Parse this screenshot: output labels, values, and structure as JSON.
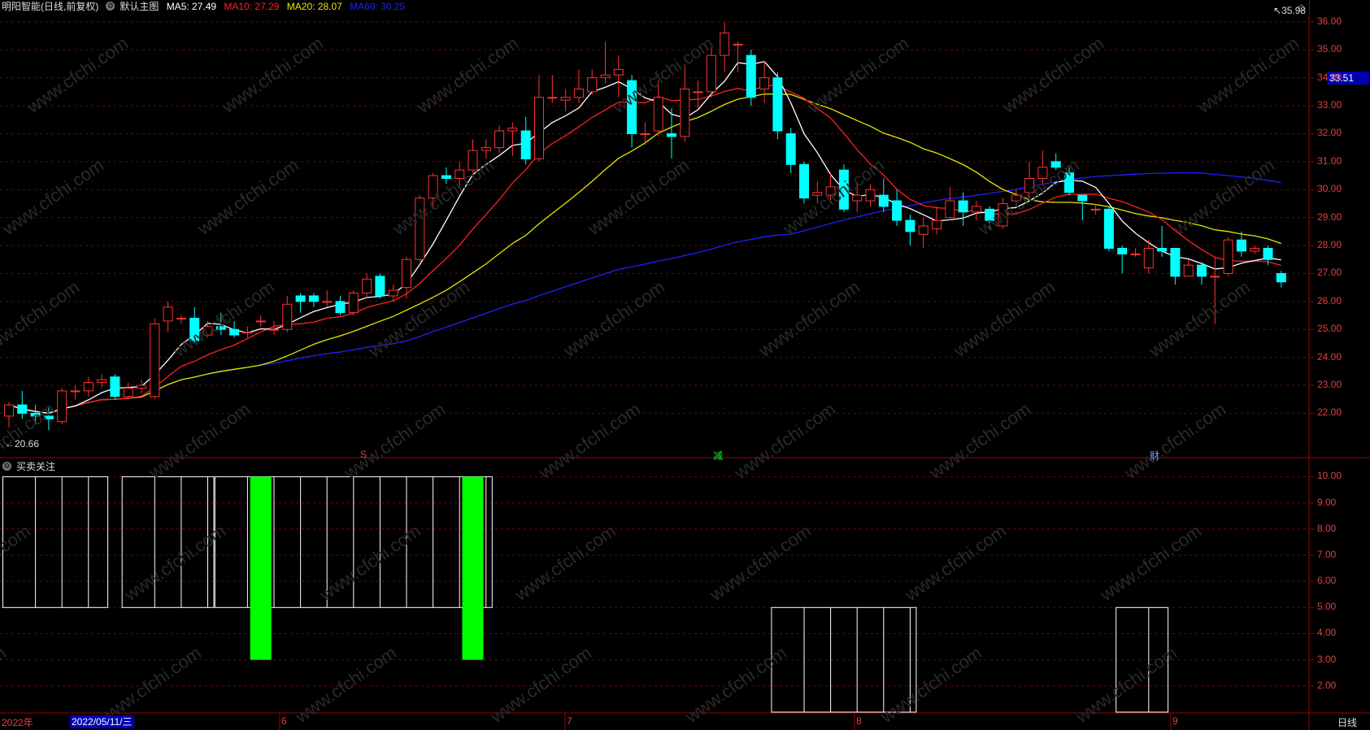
{
  "header": {
    "stock": "明阳智能(日线,前复权)",
    "view": "默认主图",
    "ma5": "MA5: 27.49",
    "ma10": "MA10: 27.29",
    "ma20": "MA20: 28.07",
    "ma60": "MA60: 30.25"
  },
  "sub_header": {
    "indicator": "买卖关注"
  },
  "price_axis": [
    "36.00",
    "35.00",
    "34.00",
    "33.00",
    "32.00",
    "31.00",
    "30.00",
    "29.00",
    "28.00",
    "27.00",
    "26.00",
    "25.00",
    "24.00",
    "23.00",
    "22.00"
  ],
  "sub_axis": [
    "10.00",
    "9.00",
    "8.00",
    "7.00",
    "6.00",
    "5.00",
    "4.00",
    "3.00",
    "2.00"
  ],
  "current_price": "33.51",
  "high_label": "35.98",
  "low_label": "20.66",
  "markers": {
    "s": "S",
    "jian": "减",
    "cai": "财"
  },
  "dates": {
    "year": "2022年",
    "selected": "2022/05/11/三",
    "m6": "6",
    "m7": "7",
    "m8": "8",
    "m9": "9"
  },
  "period": "日线",
  "colors": {
    "up": "#ff3232",
    "down": "#00ffff",
    "ma5": "#ffffff",
    "ma10": "#ff2020",
    "ma20": "#e6e600",
    "ma60": "#2020ff",
    "signal": "#00ff00",
    "grid": "#7a0000"
  },
  "chart_data": {
    "type": "candlestick",
    "title": "明阳智能(日线,前复权)",
    "ylim": [
      20.5,
      36.2
    ],
    "candles": [
      [
        21.9,
        22.3,
        21.5,
        22.4
      ],
      [
        22.3,
        22.0,
        21.8,
        22.8
      ],
      [
        22.0,
        21.9,
        21.6,
        22.3
      ],
      [
        21.9,
        21.8,
        21.4,
        22.2
      ],
      [
        21.7,
        22.8,
        21.6,
        22.9
      ],
      [
        22.8,
        22.8,
        22.5,
        23.0
      ],
      [
        22.8,
        23.1,
        22.6,
        23.3
      ],
      [
        23.1,
        23.2,
        22.9,
        23.4
      ],
      [
        23.3,
        22.6,
        22.5,
        23.4
      ],
      [
        22.6,
        22.9,
        22.5,
        23.1
      ],
      [
        22.9,
        23.0,
        22.7,
        23.2
      ],
      [
        22.6,
        25.2,
        22.5,
        25.4
      ],
      [
        25.3,
        25.8,
        24.9,
        26.0
      ],
      [
        25.4,
        25.4,
        25.2,
        25.5
      ],
      [
        25.4,
        24.6,
        24.5,
        25.8
      ],
      [
        24.8,
        25.1,
        24.7,
        25.3
      ],
      [
        25.1,
        25.0,
        24.8,
        25.6
      ],
      [
        25.0,
        24.8,
        24.7,
        25.3
      ],
      [
        24.9,
        24.9,
        24.7,
        25.1
      ],
      [
        25.3,
        25.3,
        25.1,
        25.5
      ],
      [
        25.0,
        25.0,
        24.8,
        25.3
      ],
      [
        25.0,
        25.9,
        24.9,
        26.2
      ],
      [
        26.2,
        26.0,
        25.6,
        26.3
      ],
      [
        26.2,
        26.0,
        25.8,
        26.3
      ],
      [
        26.0,
        26.0,
        25.8,
        26.4
      ],
      [
        26.0,
        25.6,
        25.5,
        26.2
      ],
      [
        25.6,
        26.3,
        25.5,
        26.4
      ],
      [
        26.3,
        26.8,
        26.1,
        27.0
      ],
      [
        26.9,
        26.2,
        26.1,
        27.0
      ],
      [
        26.2,
        26.4,
        26.0,
        26.6
      ],
      [
        26.5,
        27.5,
        26.1,
        27.6
      ],
      [
        27.5,
        29.7,
        27.4,
        29.8
      ],
      [
        29.7,
        30.5,
        29.3,
        30.6
      ],
      [
        30.5,
        30.4,
        30.2,
        30.8
      ],
      [
        30.4,
        30.7,
        30.1,
        31.0
      ],
      [
        30.7,
        31.4,
        30.5,
        31.8
      ],
      [
        31.4,
        31.5,
        31.1,
        31.8
      ],
      [
        31.5,
        32.1,
        31.3,
        32.3
      ],
      [
        32.1,
        32.2,
        31.2,
        32.4
      ],
      [
        32.1,
        31.1,
        30.9,
        32.6
      ],
      [
        31.1,
        33.3,
        31.0,
        34.1
      ],
      [
        33.3,
        33.3,
        33.1,
        34.1
      ],
      [
        33.2,
        33.3,
        32.8,
        33.6
      ],
      [
        33.3,
        33.6,
        33.1,
        34.3
      ],
      [
        33.5,
        34.0,
        33.4,
        34.3
      ],
      [
        34.0,
        34.1,
        33.8,
        35.3
      ],
      [
        34.1,
        34.3,
        33.3,
        34.8
      ],
      [
        33.9,
        32.0,
        31.5,
        34.1
      ],
      [
        32.0,
        32.0,
        31.6,
        32.4
      ],
      [
        32.1,
        33.3,
        31.9,
        33.9
      ],
      [
        32.0,
        31.9,
        31.1,
        32.9
      ],
      [
        31.9,
        33.6,
        31.7,
        34.5
      ],
      [
        33.5,
        33.5,
        32.9,
        33.9
      ],
      [
        33.5,
        34.8,
        33.3,
        35.1
      ],
      [
        34.8,
        35.6,
        34.2,
        35.98
      ],
      [
        35.2,
        35.2,
        34.2,
        35.3
      ],
      [
        34.8,
        33.3,
        33.0,
        35.0
      ],
      [
        33.6,
        34.0,
        33.1,
        34.6
      ],
      [
        34.0,
        32.1,
        31.8,
        34.2
      ],
      [
        32.0,
        30.9,
        30.6,
        32.2
      ],
      [
        30.9,
        29.7,
        29.5,
        31.0
      ],
      [
        29.8,
        29.9,
        29.5,
        30.3
      ],
      [
        29.8,
        30.1,
        29.5,
        30.6
      ],
      [
        30.7,
        29.3,
        29.2,
        30.9
      ],
      [
        29.6,
        29.8,
        29.2,
        30.2
      ],
      [
        29.6,
        30.0,
        29.4,
        30.2
      ],
      [
        29.8,
        29.4,
        29.2,
        30.4
      ],
      [
        29.6,
        28.9,
        28.7,
        30.0
      ],
      [
        28.9,
        28.5,
        28.0,
        29.1
      ],
      [
        28.4,
        28.7,
        27.9,
        29.0
      ],
      [
        28.6,
        28.9,
        28.4,
        29.4
      ],
      [
        29.0,
        29.6,
        28.9,
        30.1
      ],
      [
        29.6,
        29.2,
        28.7,
        29.9
      ],
      [
        29.2,
        29.4,
        28.9,
        29.6
      ],
      [
        29.3,
        28.9,
        28.6,
        29.4
      ],
      [
        28.7,
        29.5,
        28.6,
        29.7
      ],
      [
        29.6,
        29.8,
        29.4,
        30.0
      ],
      [
        29.9,
        30.4,
        29.7,
        31.0
      ],
      [
        30.4,
        30.8,
        30.2,
        31.4
      ],
      [
        31.0,
        30.8,
        30.7,
        31.3
      ],
      [
        30.6,
        29.9,
        29.8,
        30.8
      ],
      [
        29.8,
        29.6,
        28.9,
        29.8
      ],
      [
        29.3,
        29.3,
        29.1,
        29.5
      ],
      [
        29.3,
        27.9,
        27.8,
        29.4
      ],
      [
        27.9,
        27.7,
        27.0,
        28.0
      ],
      [
        27.7,
        27.7,
        27.6,
        27.9
      ],
      [
        27.2,
        27.9,
        27.0,
        28.2
      ],
      [
        27.9,
        27.8,
        27.6,
        28.7
      ],
      [
        27.9,
        26.9,
        26.6,
        27.9
      ],
      [
        26.9,
        27.3,
        26.9,
        27.5
      ],
      [
        27.3,
        26.9,
        26.6,
        27.4
      ],
      [
        26.9,
        26.9,
        25.2,
        27.6
      ],
      [
        27.0,
        28.2,
        26.9,
        28.3
      ],
      [
        28.2,
        27.8,
        27.6,
        28.5
      ],
      [
        27.8,
        27.9,
        27.7,
        28.0
      ],
      [
        27.9,
        27.5,
        27.3,
        28.0
      ],
      [
        27.0,
        26.7,
        26.5,
        27.1
      ]
    ],
    "ma5_last": 27.49,
    "ma10_last": 27.29,
    "ma20_last": 28.07,
    "ma60_last": 30.25,
    "sub_chart": {
      "name": "买卖关注",
      "ylim": [
        1.0,
        10.2
      ],
      "blocks": [
        {
          "from": 0,
          "to": 7,
          "low": 5,
          "high": 10
        },
        {
          "from": 9,
          "to": 15,
          "low": 5,
          "high": 10
        },
        {
          "from": 16,
          "to": 36,
          "low": 5,
          "high": 10
        },
        {
          "from": 58,
          "to": 68,
          "low": 1,
          "high": 5
        },
        {
          "from": 84,
          "to": 87,
          "low": 1,
          "high": 5
        }
      ],
      "signals": [
        {
          "index": 19,
          "low": 3,
          "high": 10
        },
        {
          "index": 35,
          "low": 3,
          "high": 10
        }
      ]
    }
  }
}
